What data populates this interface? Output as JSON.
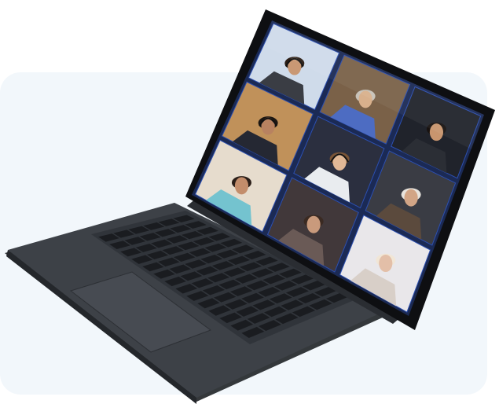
{
  "scene": {
    "subject": "laptop-video-call",
    "colors": {
      "background": "#ffffff",
      "panel": "#f2f7fb",
      "laptop_body": "#3d4147",
      "laptop_edge": "#24272b",
      "keyboard_deck": "#30343a",
      "keys": "#1a1c20",
      "trackpad": "#474b52",
      "bezel": "#0e0f12",
      "screen_bg": "#1b2a55",
      "tile_border": "#2c4fb0"
    },
    "participants": [
      {
        "tile": 1,
        "bg": "#cfdbea",
        "skin": "#c99874",
        "hair": "#2a1d15",
        "shirt": "#3a3d44",
        "headset": true
      },
      {
        "tile": 2,
        "bg": "#7a6148",
        "skin": "#d8b08c",
        "hair": "#c8c2b8",
        "shirt": "#4d6cc2",
        "headset": false
      },
      {
        "tile": 3,
        "bg": "#20232b",
        "skin": "#c8956e",
        "hair": "#181210",
        "shirt": "#2b2e35",
        "headset": false
      },
      {
        "tile": 4,
        "bg": "#c0915a",
        "skin": "#b88260",
        "hair": "#1c1612",
        "shirt": "#252833",
        "headset": true
      },
      {
        "tile": 5,
        "bg": "#2b2f3f",
        "skin": "#e1b896",
        "hair": "#7a5436",
        "shirt": "#e9ecef",
        "headset": true
      },
      {
        "tile": 6,
        "bg": "#3a3c44",
        "skin": "#d2a586",
        "hair": "#e8e4de",
        "shirt": "#5b4a3d",
        "headset": false
      },
      {
        "tile": 7,
        "bg": "#e6dccd",
        "skin": "#c38d6b",
        "hair": "#2a1e18",
        "shirt": "#74c3cf",
        "headset": false
      },
      {
        "tile": 8,
        "bg": "#41383a",
        "skin": "#c99a7c",
        "hair": "#3a2a22",
        "shirt": "#6a5a56",
        "headset": false
      },
      {
        "tile": 9,
        "bg": "#e9e7ea",
        "skin": "#e3bfa8",
        "hair": "#f1e6d6",
        "shirt": "#d8cfc8",
        "headset": false
      }
    ]
  }
}
